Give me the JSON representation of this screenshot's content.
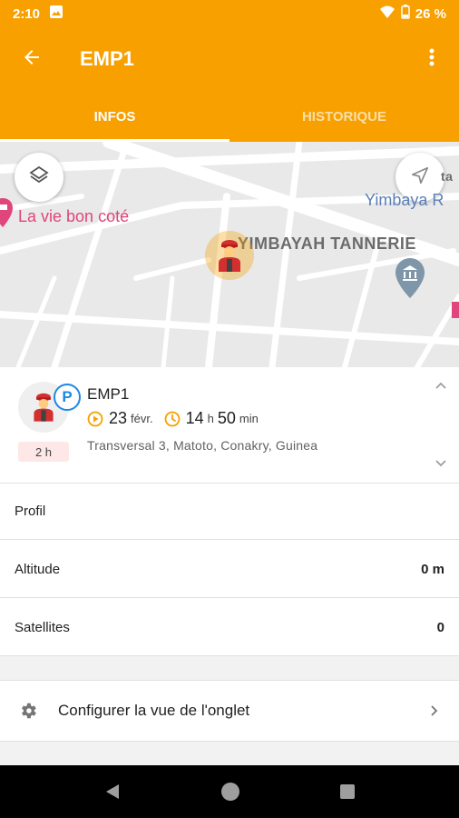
{
  "status_bar": {
    "time": "2:10",
    "battery": "26 %"
  },
  "app_bar": {
    "title": "EMP1",
    "back_icon": "arrow-back-icon",
    "menu_icon": "more-vert-icon"
  },
  "tabs": [
    {
      "label": "INFOS",
      "active": true
    },
    {
      "label": "HISTORIQUE",
      "active": false
    }
  ],
  "map": {
    "poi_restaurant": "La vie bon coté",
    "poi_tannery": "YIMBAYAH TANNERIE",
    "poi_partial": "Yimbaya R",
    "poi_partial_top": "ta"
  },
  "device": {
    "name": "EMP1",
    "badge": "P",
    "duration": "2 h",
    "date_day": "23",
    "date_month": "févr.",
    "time_hours": "14",
    "time_h_unit": "h",
    "time_minutes": "50",
    "time_min_unit": "min",
    "address": "Transversal 3, Matoto, Conakry, Guinea"
  },
  "details": {
    "profil_label": "Profil",
    "altitude_label": "Altitude",
    "altitude_value": "0 m",
    "satellites_label": "Satellites",
    "satellites_value": "0"
  },
  "config": {
    "label": "Configurer la vue de l'onglet"
  },
  "colors": {
    "accent": "#f7a000",
    "pin": "#e0457b",
    "badge_blue": "#1e88e5"
  }
}
